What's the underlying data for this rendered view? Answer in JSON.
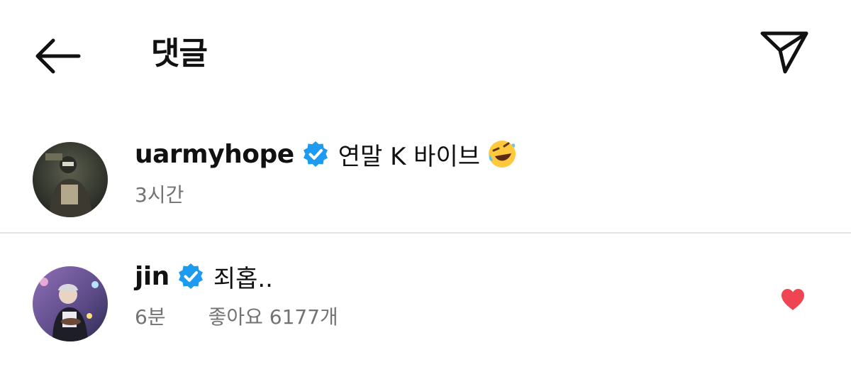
{
  "header": {
    "title": "댓글",
    "back_icon": "arrow-left-icon",
    "share_icon": "paper-plane-icon"
  },
  "colors": {
    "verified_blue": "#1d9bf0",
    "heart_red": "#ef4452",
    "meta_gray": "#737373",
    "divider": "#e4e4e4"
  },
  "comments": [
    {
      "username": "uarmyhope",
      "verified": true,
      "text": "연말 K 바이브",
      "emoji": "rolling-on-the-floor-laughing-emoji",
      "time": "3시간",
      "likes": "",
      "liked": false
    },
    {
      "username": "jin",
      "verified": true,
      "text": "죄홉..",
      "time": "6분",
      "likes": "좋아요 6177개",
      "liked": true
    }
  ]
}
